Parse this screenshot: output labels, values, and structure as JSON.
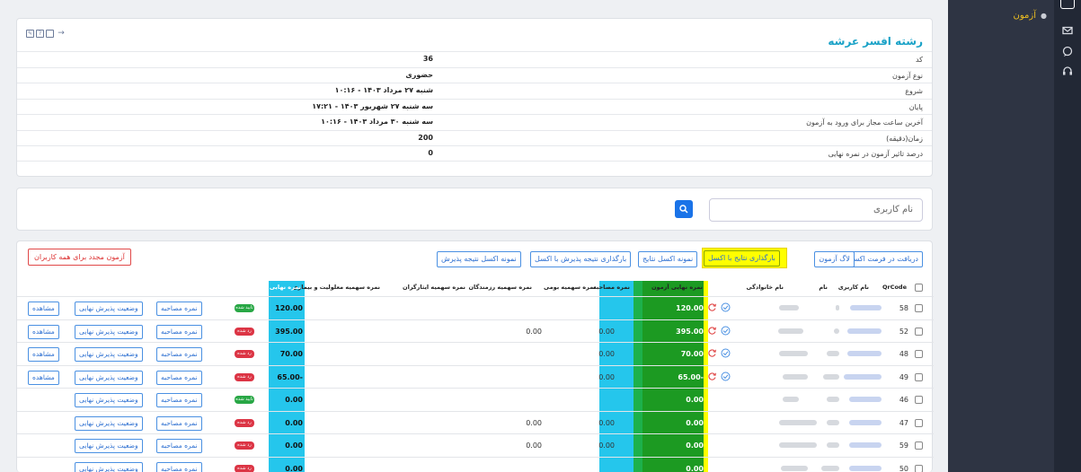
{
  "sidebar": {
    "menu_item": "آزمون"
  },
  "info": {
    "title": "رشته افسر عرشه",
    "rows": [
      {
        "label": "کد",
        "value": "36"
      },
      {
        "label": "نوع آزمون",
        "value": "حضوری"
      },
      {
        "label": "شروع",
        "value": "شنبه ۲۷ مرداد ۱۴۰۳ - ۱۰:۱۶"
      },
      {
        "label": "پایان",
        "value": "سه شنبه ۲۷ شهریور ۱۴۰۳ - ۱۷:۲۱"
      },
      {
        "label": "آخرین ساعت مجاز برای ورود به آزمون",
        "value": "سه شنبه ۳۰ مرداد ۱۴۰۳ - ۱۰:۱۶"
      },
      {
        "label": "زمان(دقیقه)",
        "value": "200"
      },
      {
        "label": "درصد تاثیر آزمون در نمره نهایی",
        "value": "0"
      }
    ]
  },
  "search": {
    "placeholder": "نام کاربری"
  },
  "toolbar": {
    "excel_export": "دریافت در فرمت اکسل",
    "exam_log": "لاگ آزمون",
    "upload_results": "بارگذاری نتایج با اکسل",
    "sample_results": "نمونه اکسل نتایج",
    "upload_admission": "بارگذاری نتیجه پذیرش با اکسل",
    "sample_admission": "نمونه اکسل نتیجه پذیرش",
    "retake_all": "آزمون مجدد برای همه کاربران"
  },
  "table": {
    "headers": {
      "qrcode": "QrCode",
      "username": "نام کاربری",
      "name": "نام",
      "family": "نام خانوادگی",
      "exam_score": "نمره نهایی آزمون",
      "interview_score": "نمره مصاحبه",
      "native_quota": "نمره سهمیه بومی",
      "fighters_quota": "نمره سهمیه رزمندگان",
      "sacrificers_quota": "نمره سهمیه ایثارگران",
      "disability_quota": "نمره سهمیه معلولیت و بیماری",
      "final_score": "نمره نهایی"
    },
    "row_buttons": {
      "view": "مشاهده",
      "status": "وضعیت پذیرش نهایی",
      "interview": "نمره مصاحبه"
    },
    "rows": [
      {
        "qrcode": "58",
        "exam": "120.00",
        "native": "",
        "fighters": "",
        "final": "120.00",
        "badge": "تایید شده",
        "badge_color": "#28a745",
        "view": true,
        "icons": true
      },
      {
        "qrcode": "52",
        "exam": "395.00",
        "native": "0.00",
        "fighters": "0.00",
        "final": "395.00",
        "badge": "رد شده",
        "badge_color": "#dc3545",
        "view": true,
        "icons": true
      },
      {
        "qrcode": "48",
        "exam": "70.00",
        "native": "0.00",
        "fighters": "",
        "final": "70.00",
        "badge": "رد شده",
        "badge_color": "#dc3545",
        "view": true,
        "icons": true
      },
      {
        "qrcode": "49",
        "exam": "65.00-",
        "native": "0.00",
        "fighters": "",
        "final": "65.00-",
        "badge": "رد شده",
        "badge_color": "#dc3545",
        "view": true,
        "icons": true
      },
      {
        "qrcode": "46",
        "exam": "0.00",
        "native": "",
        "fighters": "",
        "final": "0.00",
        "badge": "تایید شده",
        "badge_color": "#28a745",
        "view": false,
        "icons": false
      },
      {
        "qrcode": "47",
        "exam": "0.00",
        "native": "0.00",
        "fighters": "0.00",
        "final": "0.00",
        "badge": "رد شده",
        "badge_color": "#dc3545",
        "view": false,
        "icons": false
      },
      {
        "qrcode": "59",
        "exam": "0.00",
        "native": "0.00",
        "fighters": "0.00",
        "final": "0.00",
        "badge": "رد شده",
        "badge_color": "#dc3545",
        "view": false,
        "icons": false
      },
      {
        "qrcode": "50",
        "exam": "0.00",
        "native": "",
        "fighters": "",
        "final": "0.00",
        "badge": "رد شده",
        "badge_color": "#dc3545",
        "view": false,
        "icons": false
      }
    ]
  }
}
